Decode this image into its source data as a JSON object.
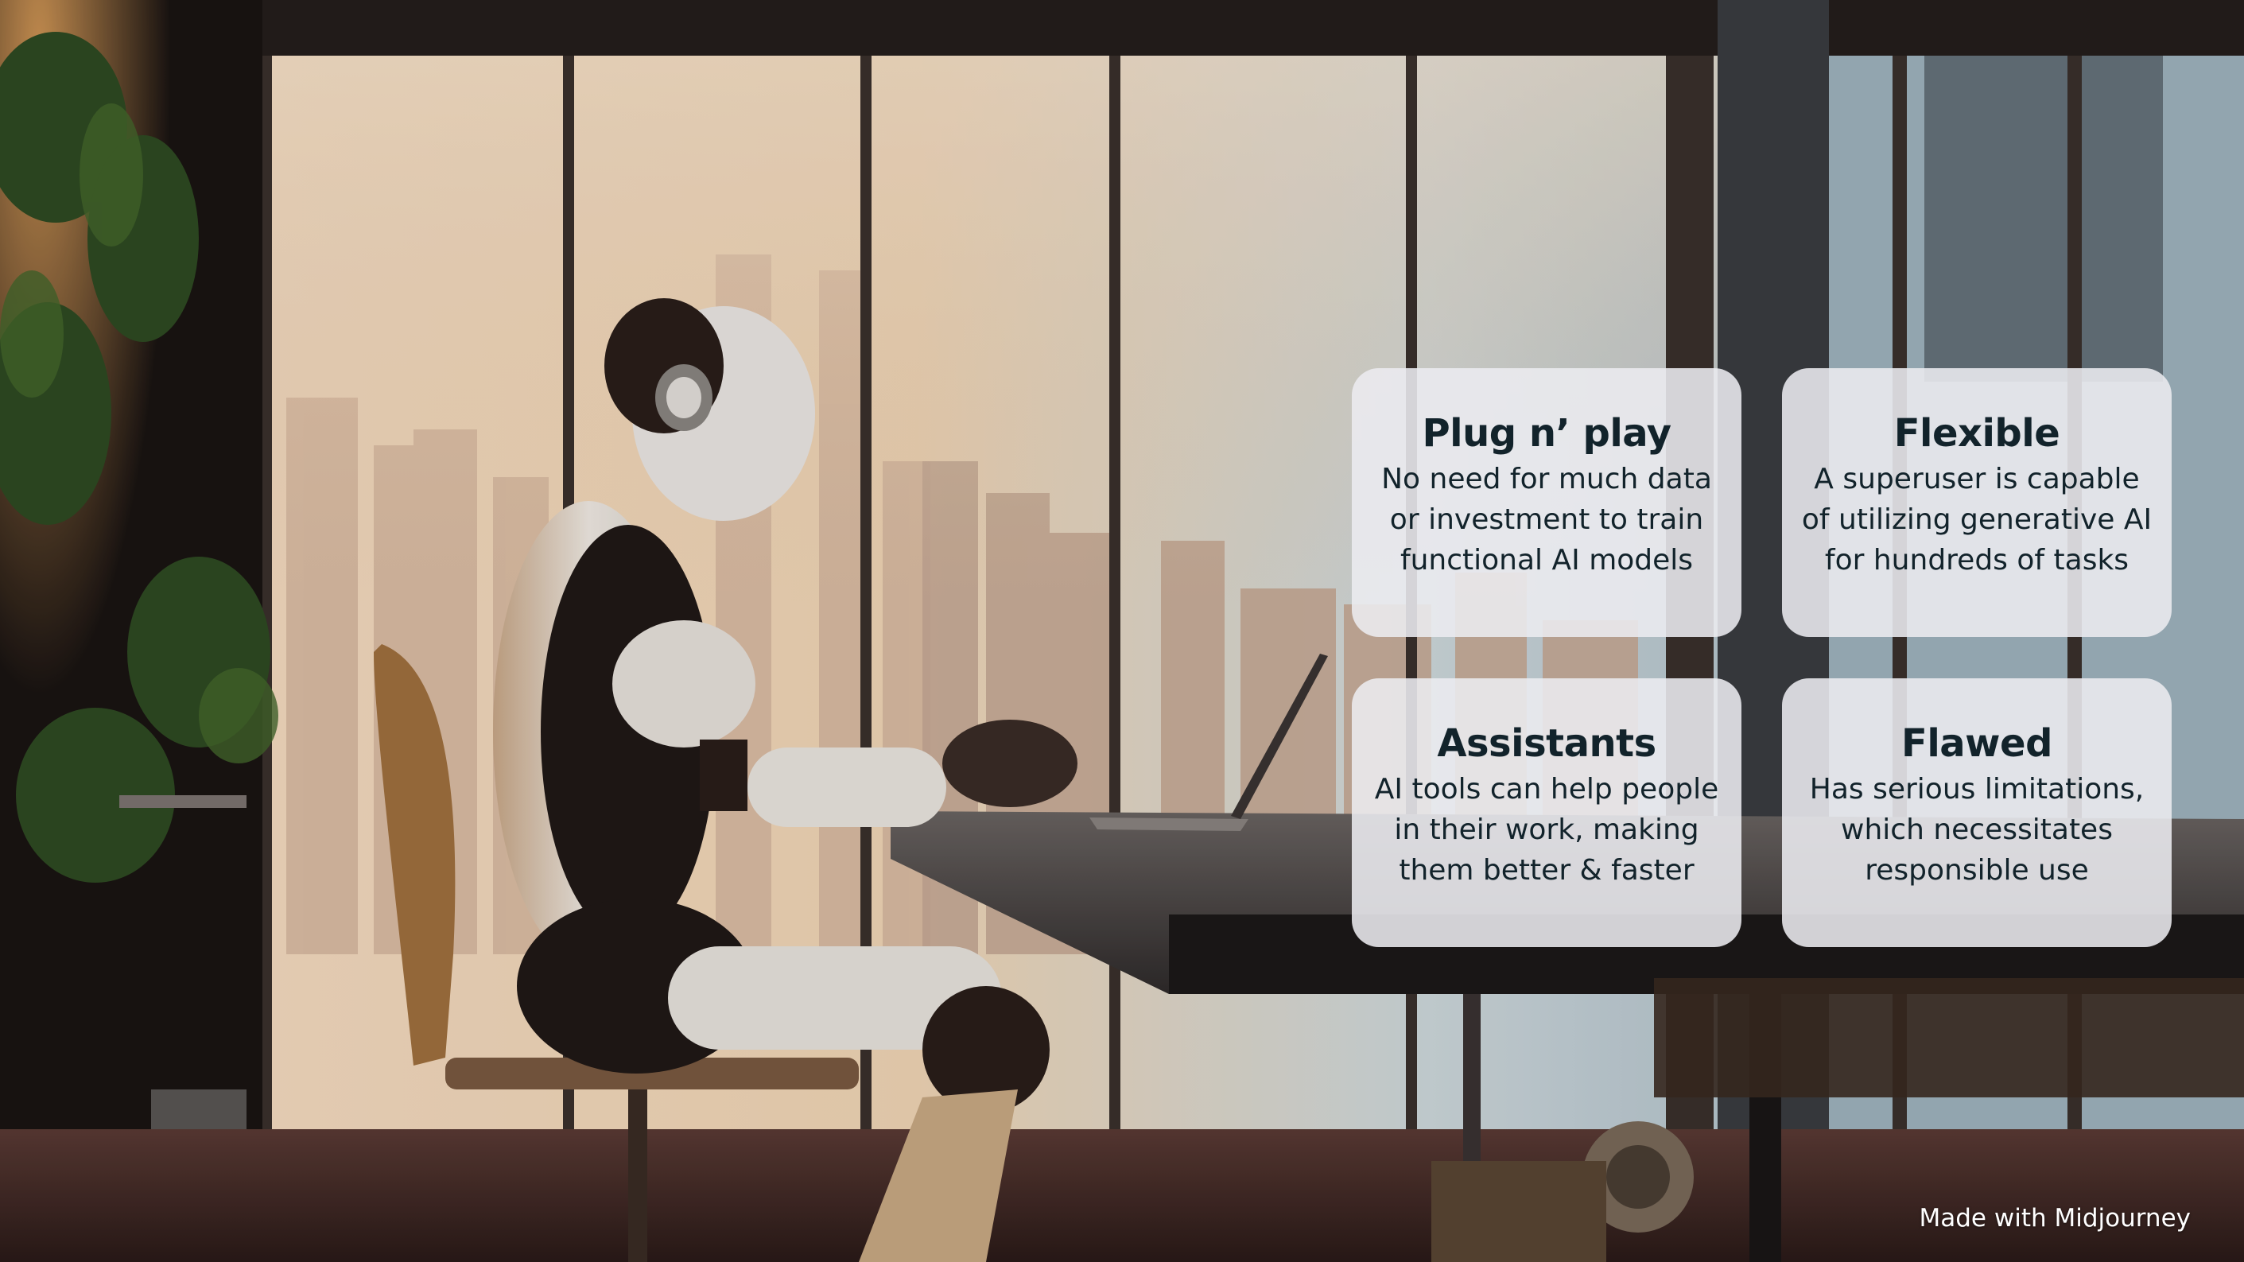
{
  "photo": {
    "subject": "robot-at-laptop-photo",
    "palette": {
      "sky_warm": "#f3d6b4",
      "sky_cool": "#c9d6dc",
      "frame_dark": "#2b2522",
      "robot_white": "#e6e3df",
      "robot_dark": "#1c1614",
      "desk_top": "#4a4442",
      "floor": "#4a2e2a"
    }
  },
  "cards": [
    {
      "title": "Plug n’ play",
      "body": "No need for much data\nor investment to train\nfunctional AI models"
    },
    {
      "title": "Flexible",
      "body": "A superuser is capable\nof utilizing generative AI\nfor hundreds of tasks"
    },
    {
      "title": "Assistants",
      "body": "AI tools can help people\nin their work, making\nthem better & faster"
    },
    {
      "title": "Flawed",
      "body": "Has serious limitations,\nwhich necessitates\nresponsible use"
    }
  ],
  "credit": "Made with Midjourney"
}
